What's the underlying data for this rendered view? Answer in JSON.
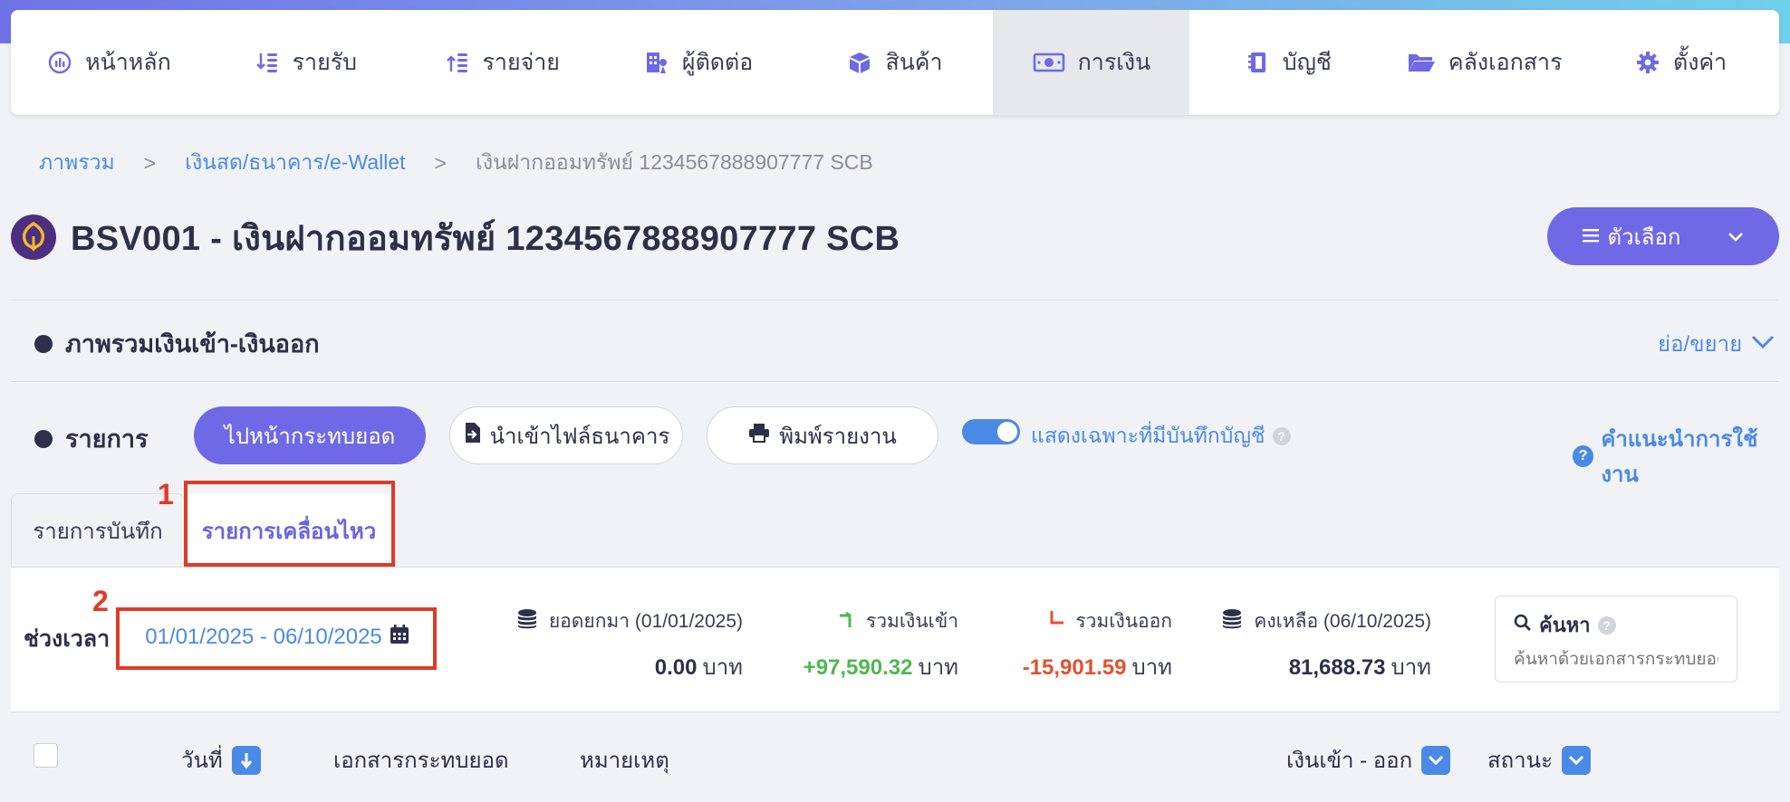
{
  "nav": {
    "items": [
      {
        "label": "หน้าหลัก",
        "icon": "dashboard-icon"
      },
      {
        "label": "รายรับ",
        "icon": "income-icon"
      },
      {
        "label": "รายจ่าย",
        "icon": "expense-icon"
      },
      {
        "label": "ผู้ติดต่อ",
        "icon": "contacts-icon"
      },
      {
        "label": "สินค้า",
        "icon": "box-icon"
      },
      {
        "label": "การเงิน",
        "icon": "money-icon"
      },
      {
        "label": "บัญชี",
        "icon": "ledger-icon"
      },
      {
        "label": "คลังเอกสาร",
        "icon": "folder-icon"
      },
      {
        "label": "ตั้งค่า",
        "icon": "gear-icon"
      }
    ],
    "active_index": 5
  },
  "breadcrumb": {
    "items": [
      "ภาพรวม",
      "เงินสด/ธนาคาร/e-Wallet"
    ],
    "separator": ">",
    "current": "เงินฝากออมทรัพย์ 1234567888907777 SCB"
  },
  "page": {
    "title": "BSV001 - เงินฝากออมทรัพย์ 1234567888907777 SCB",
    "options_label": "ตัวเลือก"
  },
  "overview": {
    "title": "ภาพรวมเงินเข้า-เงินออก",
    "collapse_label": "ย่อ/ขยาย"
  },
  "transactions": {
    "title": "รายการ",
    "reconcile_button": "ไปหน้ากระทบยอด",
    "import_button": "นำเข้าไฟล์ธนาคาร",
    "print_button": "พิมพ์รายงาน",
    "toggle_label": "แสดงเฉพาะที่มีบันทึกบัญชี",
    "toggle_on": true,
    "help_label": "คำแนะนำการใช้งาน"
  },
  "tabs": {
    "recorded": "รายการบันทึก",
    "movements": "รายการเคลื่อนไหว"
  },
  "filter": {
    "period_label": "ช่วงเวลา",
    "date_range": "01/01/2025 - 06/10/2025"
  },
  "stats": {
    "opening": {
      "label": "ยอดยกมา (01/01/2025)",
      "value": "0.00",
      "unit": "บาท"
    },
    "inflow": {
      "label": "รวมเงินเข้า",
      "value": "+97,590.32",
      "unit": "บาท"
    },
    "outflow": {
      "label": "รวมเงินออก",
      "value": "-15,901.59",
      "unit": "บาท"
    },
    "balance": {
      "label": "คงเหลือ (06/10/2025)",
      "value": "81,688.73",
      "unit": "บาท"
    }
  },
  "search": {
    "title": "ค้นหา",
    "placeholder": "ค้นหาด้วยเอกสารกระทบยอด"
  },
  "table": {
    "columns": [
      "วันที่",
      "เอกสารกระทบยอด",
      "หมายเหตุ",
      "เงินเข้า - ออก",
      "สถานะ"
    ]
  },
  "annotations": [
    "1",
    "2"
  ],
  "colors": {
    "primary": "#6f69e6",
    "link": "#4a8ae6",
    "positive": "#4fb84f",
    "negative": "#e1522f",
    "annotation": "#e03b26"
  }
}
